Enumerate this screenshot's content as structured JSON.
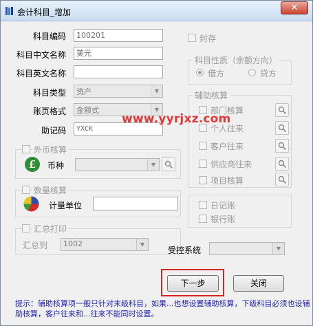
{
  "window": {
    "title": "会计科目_增加",
    "close_label": "✕"
  },
  "fields": {
    "code_label": "科目编码",
    "code_value": "100201",
    "cn_name_label": "科目中文名称",
    "cn_name_value": "美元",
    "en_name_label": "科目英文名称",
    "en_name_value": "",
    "type_label": "科目类型",
    "type_value": "资产",
    "page_format_label": "账页格式",
    "page_format_value": "金额式",
    "mnemonic_label": "助记码",
    "mnemonic_value": "YXCK"
  },
  "seal": {
    "label": "封存"
  },
  "nature": {
    "title": "科目性质（余额方向）",
    "debit_label": "借方",
    "credit_label": "贷方",
    "selected": "借方"
  },
  "aux": {
    "title": "辅助核算",
    "items": [
      "部门核算",
      "个人往来",
      "客户往来",
      "供应商往来",
      "项目核算"
    ]
  },
  "foreign": {
    "title": "外币核算",
    "currency_label": "币种",
    "currency_value": ""
  },
  "quantity": {
    "title": "数量核算",
    "unit_label": "计量单位",
    "unit_value": ""
  },
  "journal": {
    "daily_label": "日记账",
    "bank_label": "银行账"
  },
  "summary": {
    "title": "汇总打印",
    "to_label": "汇总到",
    "to_value": "1002"
  },
  "controlled": {
    "label": "受控系统",
    "value": ""
  },
  "buttons": {
    "next_label": "下一步",
    "close_label": "关闭"
  },
  "hint": "提示：辅助核算项一般只针对末级科目，如果...也想设置辅助核算，下级科目必须也设辅助核算，客户往来和...往来不能同时设置。",
  "watermark": "www.yyrjxz.com",
  "colors": {
    "highlight": "#d8231c",
    "hint_text": "#2424b8",
    "watermark": "#e03a3a"
  }
}
